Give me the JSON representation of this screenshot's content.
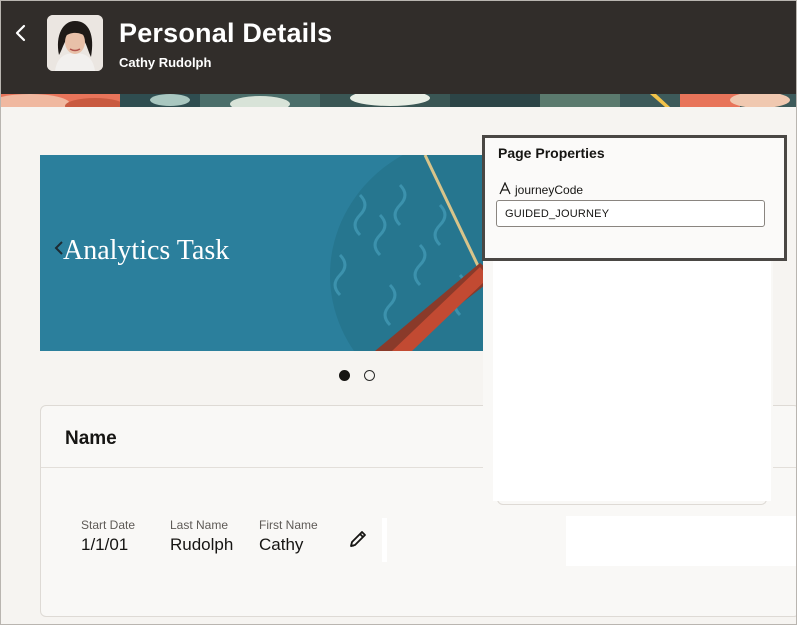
{
  "header": {
    "title": "Personal Details",
    "subtitle": "Cathy Rudolph",
    "back_icon": "chevron-left-icon",
    "background": "#312d2a"
  },
  "banner": {
    "title": "Analytics Task",
    "background": "#2a7f9b",
    "prev_icon": "chevron-left-icon"
  },
  "carousel": {
    "page_count": 2,
    "active_index": 0
  },
  "name_card": {
    "title": "Name",
    "fields": [
      {
        "label": "Start Date",
        "value": "1/1/01"
      },
      {
        "label": "Last Name",
        "value": "Rudolph"
      },
      {
        "label": "First Name",
        "value": "Cathy"
      }
    ],
    "edit_icon": "pencil-icon"
  },
  "page_properties": {
    "title": "Page Properties",
    "property_icon": "text-type-icon",
    "property_label": "journeyCode",
    "property_value": "GUIDED_JOURNEY"
  }
}
